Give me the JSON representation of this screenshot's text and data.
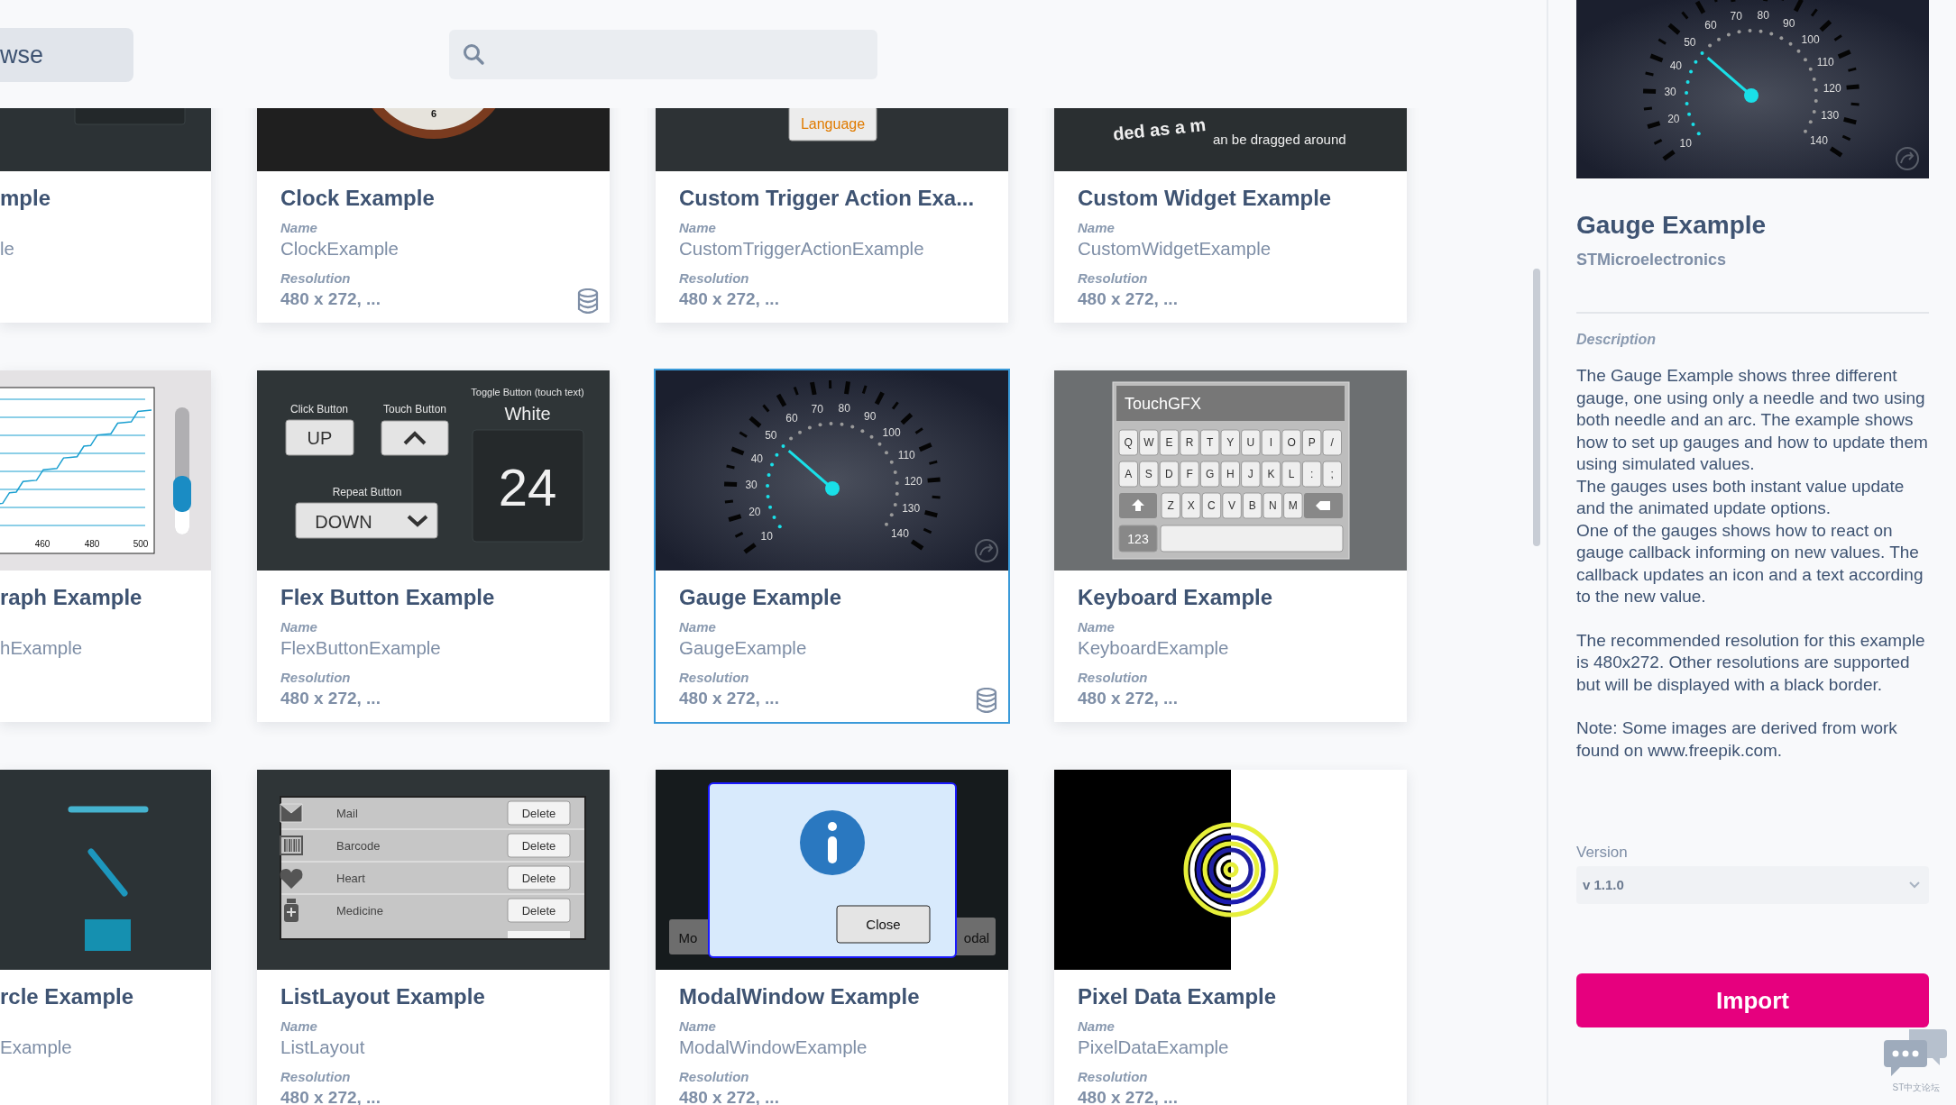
{
  "header": {
    "browse_button": "wse"
  },
  "cards": [
    {
      "title": "mple",
      "name": "le",
      "selected": false,
      "database": false,
      "thumbnail": {
        "kind": "dark"
      }
    },
    {
      "title": "Clock Example",
      "name_label": "Name",
      "name": "ClockExample",
      "resolution_label": "Resolution",
      "resolution": "480 x 272, ...",
      "selected": false,
      "database": true,
      "thumbnail": {
        "kind": "clock",
        "numeral": "6"
      }
    },
    {
      "title": "Custom Trigger Action Exa...",
      "name_label": "Name",
      "name": "CustomTriggerActionExample",
      "resolution_label": "Resolution",
      "resolution": "480 x 272, ...",
      "selected": false,
      "database": false,
      "thumbnail": {
        "kind": "language",
        "button": "Language"
      }
    },
    {
      "title": "Custom Widget Example",
      "name_label": "Name",
      "name": "CustomWidgetExample",
      "resolution_label": "Resolution",
      "resolution": "480 x 272, ...",
      "selected": false,
      "database": false,
      "thumbnail": {
        "kind": "widget",
        "curved_text": "ded as a m",
        "caption": "an be dragged around"
      }
    },
    {
      "title": "raph Example",
      "name": "hExample",
      "selected": false,
      "database": false,
      "thumbnail": {
        "kind": "graph",
        "x_labels": [
          "460",
          "480",
          "500"
        ]
      }
    },
    {
      "title": "Flex Button Example",
      "name_label": "Name",
      "name": "FlexButtonExample",
      "resolution_label": "Resolution",
      "resolution": "480 x 272, ...",
      "selected": false,
      "database": false,
      "thumbnail": {
        "kind": "flex",
        "toggle_label": "Toggle Button (touch text)",
        "click_label": "Click Button",
        "touch_label": "Touch Button",
        "toggle_value": "White",
        "click_button": "UP",
        "repeat_label": "Repeat Button",
        "repeat_button": "DOWN",
        "counter": "24"
      }
    },
    {
      "title": "Gauge Example",
      "name_label": "Name",
      "name": "GaugeExample",
      "resolution_label": "Resolution",
      "resolution": "480 x 272, ...",
      "selected": true,
      "database": true,
      "thumbnail": {
        "kind": "gauge",
        "numbers": [
          "70",
          "80",
          "60",
          "90",
          "50",
          "100",
          "40",
          "110",
          "30",
          "120",
          "20",
          "130",
          "10",
          "140"
        ]
      }
    },
    {
      "title": "Keyboard Example",
      "name_label": "Name",
      "name": "KeyboardExample",
      "resolution_label": "Resolution",
      "resolution": "480 x 272, ...",
      "selected": false,
      "database": false,
      "thumbnail": {
        "kind": "keyboard",
        "field": "TouchGFX",
        "keys": [
          [
            "Q",
            "W",
            "E",
            "R",
            "T",
            "Y",
            "U",
            "I",
            "O",
            "P",
            "/"
          ],
          [
            "A",
            "S",
            "D",
            "F",
            "G",
            "H",
            "J",
            "K",
            "L",
            ":",
            ";"
          ],
          [
            "Z",
            "X",
            "C",
            "V",
            "B",
            "N",
            "M"
          ]
        ],
        "numbers_key": "123"
      }
    },
    {
      "title": "rcle Example",
      "name": "Example",
      "selected": false,
      "database": false,
      "thumbnail": {
        "kind": "circle"
      }
    },
    {
      "title": "ListLayout Example",
      "name_label": "Name",
      "name": "ListLayout",
      "resolution_label": "Resolution",
      "resolution": "480 x 272, ...",
      "selected": false,
      "database": false,
      "thumbnail": {
        "kind": "list",
        "items": [
          {
            "label": "Mail",
            "action": "Delete"
          },
          {
            "label": "Barcode",
            "action": "Delete"
          },
          {
            "label": "Heart",
            "action": "Delete"
          },
          {
            "label": "Medicine",
            "action": "Delete"
          }
        ]
      }
    },
    {
      "title": "ModalWindow Example",
      "name_label": "Name",
      "name": "ModalWindowExample",
      "resolution_label": "Resolution",
      "resolution": "480 x 272, ...",
      "selected": false,
      "database": false,
      "thumbnail": {
        "kind": "modal",
        "left_button": "Mo",
        "right_button": "odal",
        "close": "Close"
      }
    },
    {
      "title": "Pixel Data Example",
      "name_label": "Name",
      "name": "PixelDataExample",
      "resolution_label": "Resolution",
      "resolution": "480 x 272, ...",
      "selected": false,
      "database": false,
      "thumbnail": {
        "kind": "pixel"
      }
    }
  ],
  "detail": {
    "preview": {
      "kind": "gauge",
      "numbers": [
        "70",
        "80",
        "60",
        "90",
        "50",
        "100",
        "40",
        "110",
        "30",
        "120",
        "20",
        "130",
        "10",
        "140"
      ]
    },
    "title": "Gauge Example",
    "vendor": "STMicroelectronics",
    "description_label": "Description",
    "description": [
      [
        "The Gauge Example shows three different gauge, one using only a needle and two using both needle and an arc. The example shows how to set up gauges and how to update them using simulated values.",
        "The gauges uses both instant value update and the animated update options.",
        "One of the gauges shows how to react on gauge callback informing on new values. The callback updates an icon and a text according to the new value."
      ],
      [
        "The recommended resolution for this example is 480x272. Other resolutions are supported but will be displayed with a black border."
      ],
      [
        "Note: Some images are derived from work found on www.freepik.com."
      ]
    ],
    "version_label": "Version",
    "version": "v 1.1.0",
    "import_button": "Import",
    "forum_label": "ST中文论坛"
  }
}
